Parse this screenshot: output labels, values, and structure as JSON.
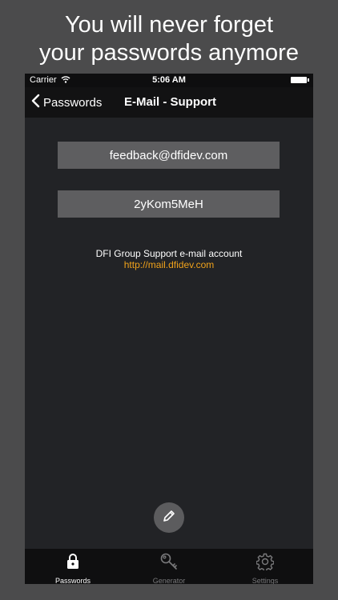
{
  "headline": {
    "line1": "You will never forget",
    "line2": "your passwords anymore"
  },
  "status_bar": {
    "carrier": "Carrier",
    "time": "5:06 AM"
  },
  "nav": {
    "back_label": "Passwords",
    "title": "E-Mail - Support"
  },
  "entry": {
    "login": "feedback@dfidev.com",
    "password": "2yKom5MeH",
    "note": "DFI Group Support e-mail account",
    "url": "http://mail.dfidev.com"
  },
  "tabs": [
    {
      "label": "Passwords",
      "icon": "lock-icon",
      "active": true
    },
    {
      "label": "Generator",
      "icon": "key-icon",
      "active": false
    },
    {
      "label": "Settings",
      "icon": "gear-icon",
      "active": false
    }
  ],
  "colors": {
    "background": "#4b4b4c",
    "screen": "#222326",
    "field": "#5e5e60",
    "link": "#f0a21b",
    "tab_active": "#ffffff",
    "tab_inactive": "#7a7a7c"
  }
}
